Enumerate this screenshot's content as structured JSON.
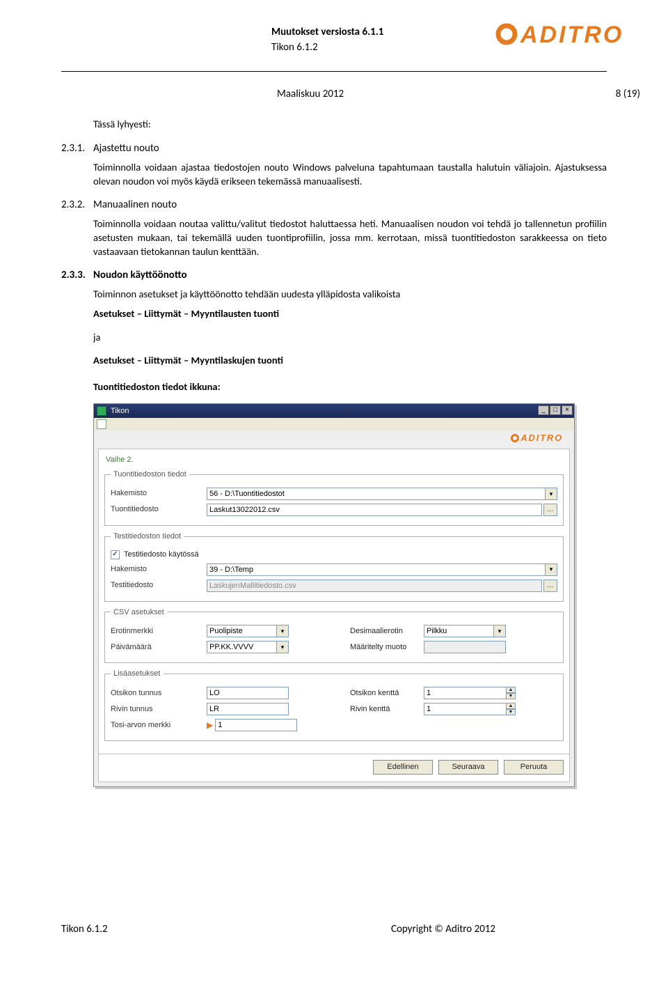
{
  "header": {
    "title": "Muutokset versiosta 6.1.1",
    "subtitle": "Tikon 6.1.2",
    "logo_text": "ADITRO"
  },
  "dateline": {
    "date": "Maaliskuu 2012",
    "page": "8 (19)"
  },
  "intro_label": "Tässä lyhyesti:",
  "s231": {
    "num": "2.3.1.",
    "title": "Ajastettu nouto",
    "body": "Toiminnolla voidaan ajastaa tiedostojen nouto Windows palveluna tapahtumaan taustalla halutuin väliajoin. Ajastuksessa olevan noudon voi myös käydä erikseen tekemässä manuaalisesti."
  },
  "s232": {
    "num": "2.3.2.",
    "title": "Manuaalinen nouto",
    "body": "Toiminnolla voidaan noutaa valittu/valitut tiedostot haluttaessa heti. Manuaalisen noudon voi tehdä jo tallennetun profiilin asetusten mukaan, tai tekemällä uuden tuontiprofiilin, jossa mm. kerrotaan, missä tuontitiedoston sarakkeessa on tieto vastaavaan tietokannan taulun kenttään."
  },
  "s233": {
    "num": "2.3.3.",
    "title": "Noudon käyttöönotto",
    "lead": "Toiminnon asetukset ja käyttöönotto tehdään uudesta ylläpidosta valikoista",
    "path1": "Asetukset – Liittymät – Myyntilausten tuonti",
    "ja": "ja",
    "path2": "Asetukset – Liittymät – Myyntilaskujen tuonti",
    "shot_heading": "Tuontitiedoston tiedot ikkuna:"
  },
  "window": {
    "title": "Tikon",
    "step": "Vaihe 2.",
    "logo": "ADITRO",
    "group1": {
      "legend": "Tuontitiedoston tiedot",
      "hakemisto_lbl": "Hakemisto",
      "hakemisto_val": "56 - D:\\Tuontitiedostot",
      "tiedosto_lbl": "Tuontitiedosto",
      "tiedosto_val": "Laskut13022012.csv"
    },
    "group2": {
      "legend": "Testitiedoston tiedot",
      "chk_lbl": "Testitiedosto käytössä",
      "chk_checked": "✓",
      "hakemisto_lbl": "Hakemisto",
      "hakemisto_val": "39 - D:\\Temp",
      "tiedosto_lbl": "Testitiedosto",
      "tiedosto_val": "LaskujenMallitiedosto.csv"
    },
    "group3": {
      "legend": "CSV asetukset",
      "erotin_lbl": "Erotinmerkki",
      "erotin_val": "Puolipiste",
      "desim_lbl": "Desimaalierotin",
      "desim_val": "Pilkku",
      "pvm_lbl": "Päivämäärä",
      "pvm_val": "PP.KK.VVVV",
      "muoto_lbl": "Määritelty muoto",
      "muoto_val": ""
    },
    "group4": {
      "legend": "Lisäasetukset",
      "ott_lbl": "Otsikon tunnus",
      "ott_val": "LO",
      "otk_lbl": "Otsikon kenttä",
      "otk_val": "1",
      "rt_lbl": "Rivin tunnus",
      "rt_val": "LR",
      "rk_lbl": "Rivin kenttä",
      "rk_val": "1",
      "tosi_lbl": "Tosi-arvon merkki",
      "tosi_val": "1"
    },
    "buttons": {
      "prev": "Edellinen",
      "next": "Seuraava",
      "cancel": "Peruuta"
    }
  },
  "footer": {
    "left": "Tikon 6.1.2",
    "right": "Copyright © Aditro 2012"
  }
}
